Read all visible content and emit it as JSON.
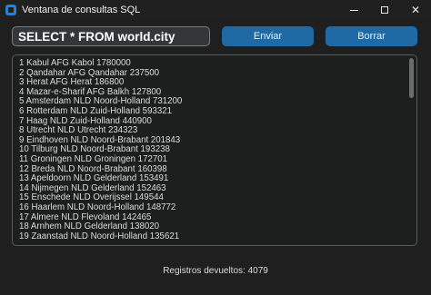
{
  "window": {
    "title": "Ventana de consultas SQL",
    "controls": {
      "minimize": "",
      "maximize": "",
      "close": "✕"
    }
  },
  "query": {
    "value": "SELECT * FROM world.city"
  },
  "buttons": {
    "send_label": "Enviar",
    "clear_label": "Borrar"
  },
  "results": {
    "rows": [
      "1 Kabul AFG Kabol 1780000",
      "2 Qandahar AFG Qandahar 237500",
      "3 Herat AFG Herat 186800",
      "4 Mazar-e-Sharif AFG Balkh 127800",
      "5 Amsterdam NLD Noord-Holland 731200",
      "6 Rotterdam NLD Zuid-Holland 593321",
      "7 Haag NLD Zuid-Holland 440900",
      "8 Utrecht NLD Utrecht 234323",
      "9 Eindhoven NLD Noord-Brabant 201843",
      "10 Tilburg NLD Noord-Brabant 193238",
      "11 Groningen NLD Groningen 172701",
      "12 Breda NLD Noord-Brabant 160398",
      "13 Apeldoorn NLD Gelderland 153491",
      "14 Nijmegen NLD Gelderland 152463",
      "15 Enschede NLD Overijssel 149544",
      "16 Haarlem NLD Noord-Holland 148772",
      "17 Almere NLD Flevoland 142465",
      "18 Arnhem NLD Gelderland 138020",
      "19 Zaanstad NLD Noord-Holland 135621"
    ]
  },
  "status": {
    "text": "Registros devueltos: 4079"
  },
  "colors": {
    "accent": "#1f6aa5",
    "background": "#1f1f1f",
    "input_background": "#343638"
  }
}
